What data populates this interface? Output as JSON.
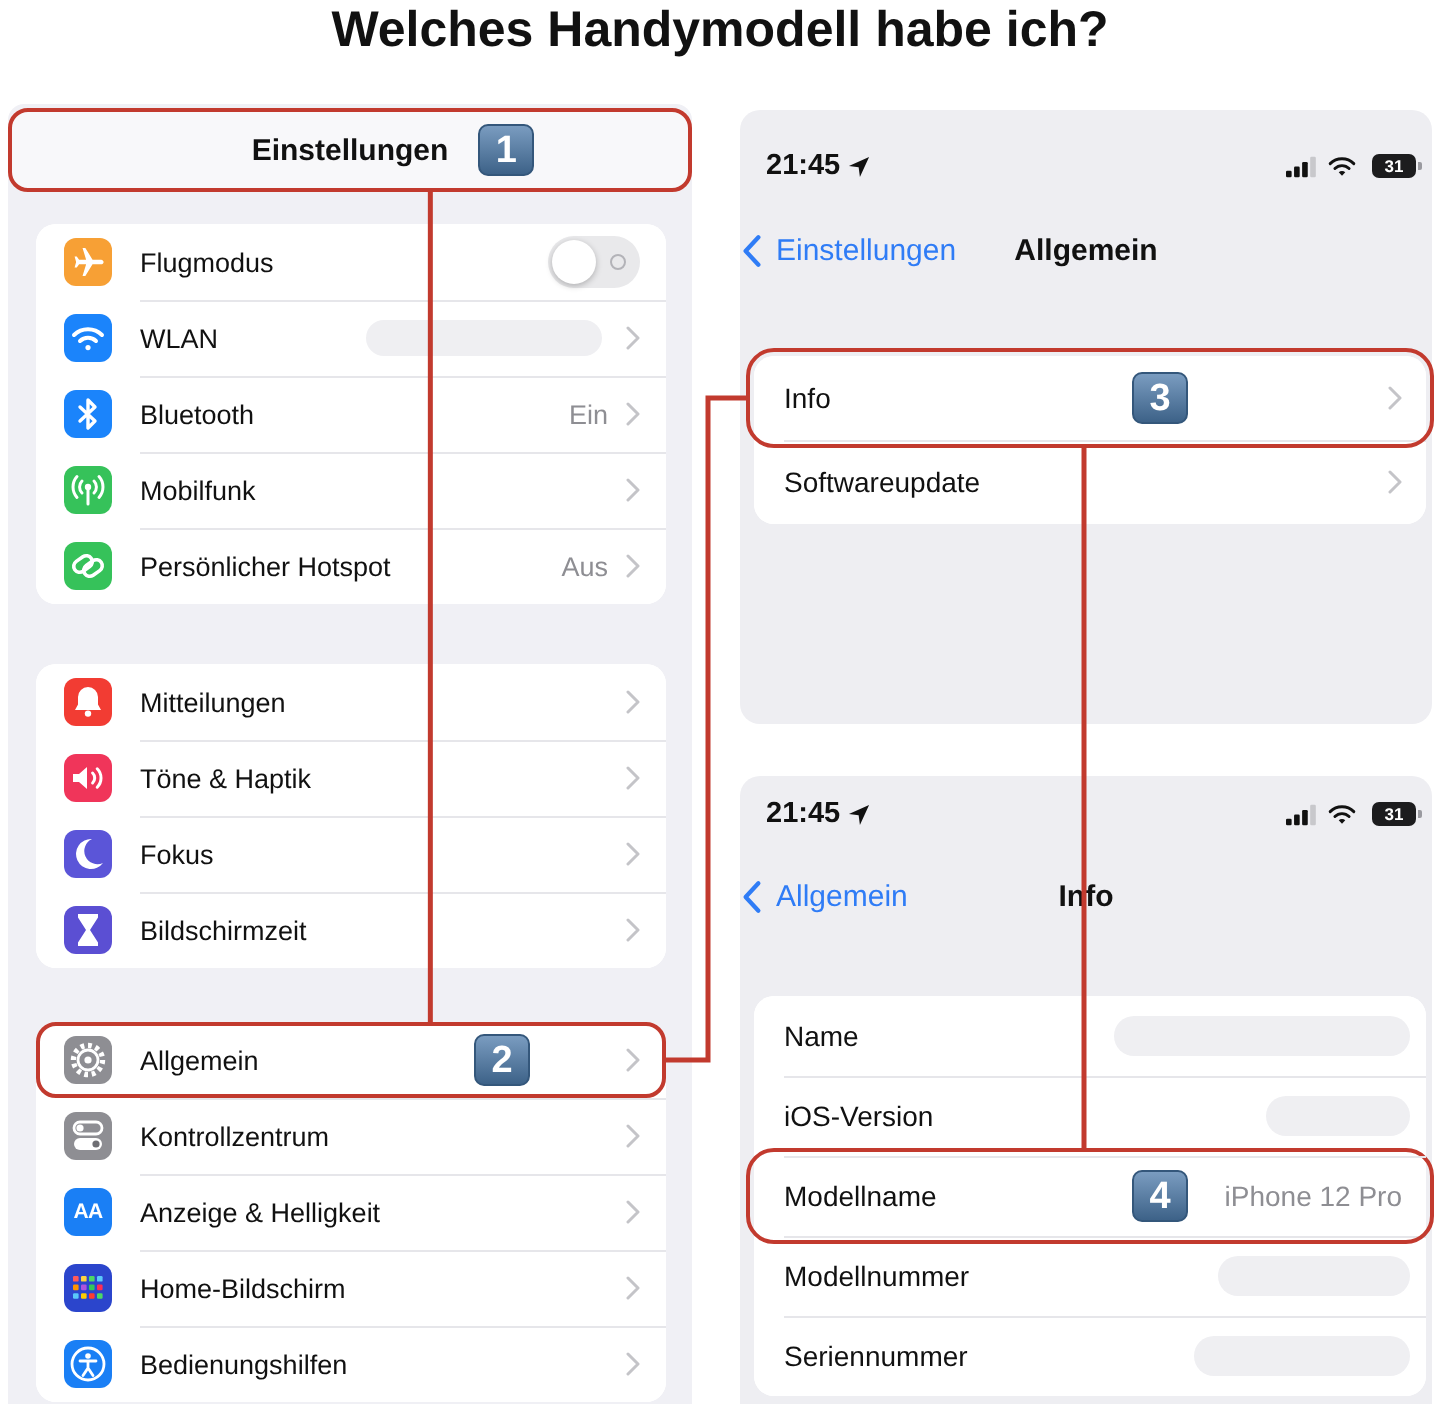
{
  "title": "Welches Handymodell habe ich?",
  "settings": {
    "header": {
      "title": "Einstellungen",
      "highlighted": true,
      "badge": "1"
    },
    "groups": [
      {
        "rows": [
          {
            "kind": "toggle",
            "label": "Flugmodus",
            "color": "#f7a035",
            "on": false,
            "redacted": false,
            "highlighted": false
          },
          {
            "kind": "link",
            "label": "WLAN",
            "color": "#1b84fb",
            "redacted": true,
            "highlighted": false
          },
          {
            "kind": "link",
            "label": "Bluetooth",
            "color": "#1b84fb",
            "value": "Ein",
            "redacted": false,
            "highlighted": false
          },
          {
            "kind": "link",
            "label": "Mobilfunk",
            "color": "#36c25a",
            "redacted": false,
            "highlighted": false
          },
          {
            "kind": "link",
            "label": "Persönlicher Hotspot",
            "color": "#36c25a",
            "value": "Aus",
            "redacted": false,
            "highlighted": false
          }
        ]
      },
      {
        "rows": [
          {
            "kind": "link",
            "label": "Mitteilungen",
            "color": "#f23c33",
            "redacted": false,
            "highlighted": false
          },
          {
            "kind": "link",
            "label": "Töne & Haptik",
            "color": "#f0355a",
            "redacted": false,
            "highlighted": false
          },
          {
            "kind": "link",
            "label": "Fokus",
            "color": "#5b55d8",
            "redacted": false,
            "highlighted": false
          },
          {
            "kind": "link",
            "label": "Bildschirmzeit",
            "color": "#5b4fd3",
            "redacted": false,
            "highlighted": false
          }
        ]
      },
      {
        "rows": [
          {
            "kind": "link",
            "label": "Allgemein",
            "color": "#8e8e93",
            "redacted": false,
            "highlighted": true,
            "badge": "2"
          },
          {
            "kind": "link",
            "label": "Kontrollzentrum",
            "color": "#8e8e93",
            "redacted": false,
            "highlighted": false
          },
          {
            "kind": "link",
            "label": "Anzeige & Helligkeit",
            "color": "#1a7ff5",
            "icon_text": "AA",
            "redacted": false,
            "highlighted": false
          },
          {
            "kind": "link",
            "label": "Home-Bildschirm",
            "color": "#2b45cc",
            "redacted": false,
            "highlighted": false
          },
          {
            "kind": "link",
            "label": "Bedienungshilfen",
            "color": "#1a7ff5",
            "redacted": false,
            "highlighted": false
          }
        ]
      }
    ]
  },
  "general_screen": {
    "status_bar": {
      "time": "21:45",
      "battery": "31"
    },
    "back": "Einstellungen",
    "title": "Allgemein",
    "rows": [
      {
        "label": "Info",
        "highlighted": true,
        "badge": "3"
      },
      {
        "label": "Softwareupdate",
        "highlighted": false
      }
    ]
  },
  "info_screen": {
    "status_bar": {
      "time": "21:45",
      "battery": "31"
    },
    "back": "Allgemein",
    "title": "Info",
    "rows": [
      {
        "label": "Name",
        "redacted": true,
        "highlighted": false
      },
      {
        "label": "iOS-Version",
        "redacted": true,
        "highlighted": false
      },
      {
        "label": "Modellname",
        "value": "iPhone 12 Pro",
        "redacted": false,
        "highlighted": true,
        "badge": "4"
      },
      {
        "label": "Modellnummer",
        "redacted": true,
        "highlighted": false
      },
      {
        "label": "Seriennummer",
        "redacted": true,
        "highlighted": false
      }
    ]
  }
}
